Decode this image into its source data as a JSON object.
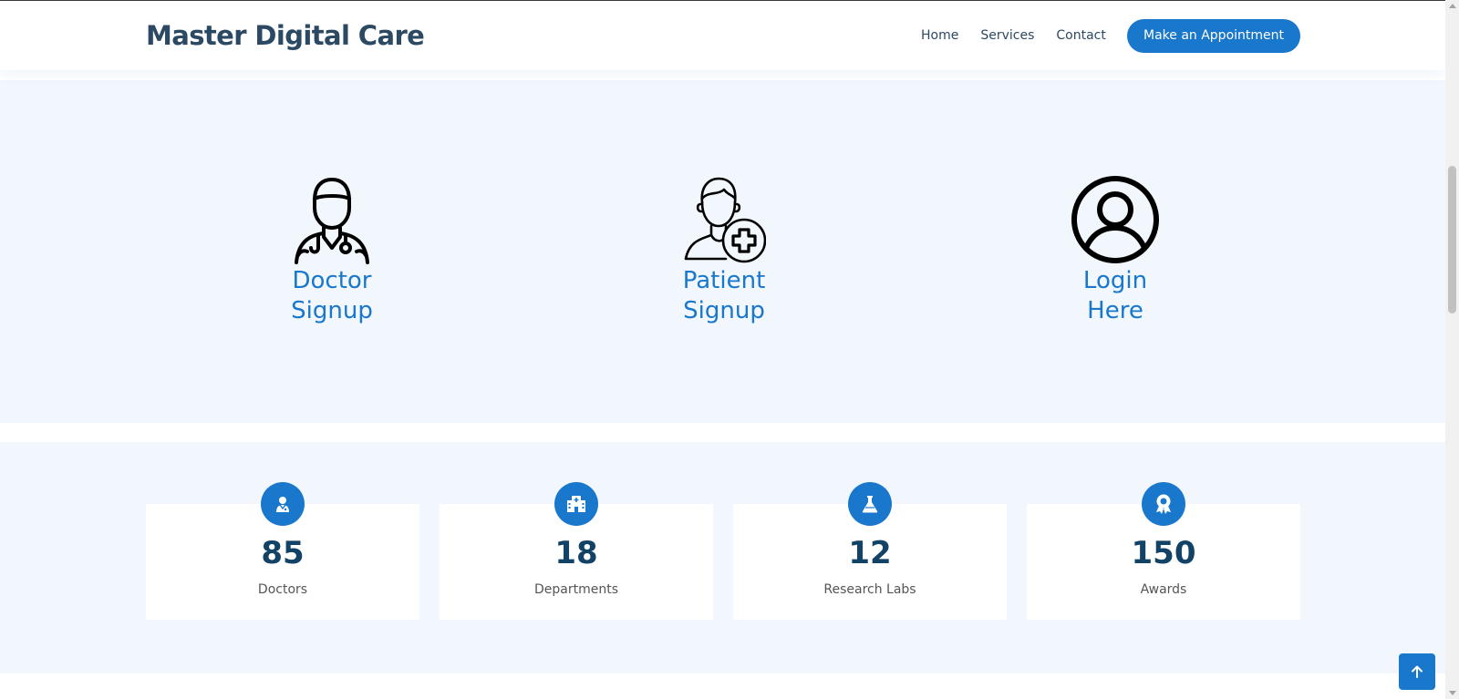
{
  "header": {
    "logo": "Master Digital Care",
    "nav": [
      {
        "label": "Home"
      },
      {
        "label": "Services"
      },
      {
        "label": "Contact"
      }
    ],
    "cta_label": "Make an Appointment"
  },
  "signup": [
    {
      "line1": "Doctor",
      "line2": "Signup",
      "icon": "doctor-icon"
    },
    {
      "line1": "Patient",
      "line2": "Signup",
      "icon": "patient-add-icon"
    },
    {
      "line1": "Login",
      "line2": "Here",
      "icon": "user-circle-icon"
    }
  ],
  "counts": [
    {
      "value": "85",
      "label": "Doctors",
      "icon": "doctor-badge-icon"
    },
    {
      "value": "18",
      "label": "Departments",
      "icon": "hospital-icon"
    },
    {
      "value": "12",
      "label": "Research Labs",
      "icon": "flask-icon"
    },
    {
      "value": "150",
      "label": "Awards",
      "icon": "award-icon"
    }
  ],
  "back_to_top_icon": "arrow-up-icon",
  "colors": {
    "accent": "#1977cc",
    "heading": "#2c4964",
    "section_bg": "#f1f7fd",
    "count_number": "#124265"
  }
}
